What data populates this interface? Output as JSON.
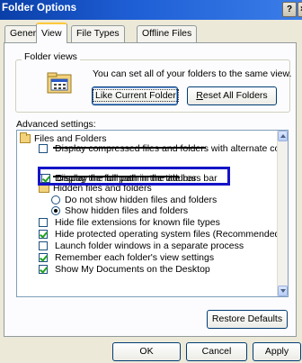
{
  "window": {
    "title": "Folder Options",
    "help_label": "?",
    "close_label": "×"
  },
  "tabs": [
    {
      "label": "General"
    },
    {
      "label": "View"
    },
    {
      "label": "File Types"
    },
    {
      "label": "Offline Files"
    }
  ],
  "folder_views": {
    "title": "Folder views",
    "description": "You can set all of your folders to the same view.",
    "like_current_label": "Like Current Folder",
    "reset_all_label": "Reset All Folders"
  },
  "advanced": {
    "label": "Advanced settings:",
    "group_label": "Files and Folders",
    "obscured_label": "Display compressed files and folders with alternate color",
    "highlighted_label": "Display the full path in the address bar",
    "obscured_label_2": "Display the full path in the title bar",
    "hidden_group_label": "Hidden files and folders",
    "hidden_option_1": "Do not show hidden files and folders",
    "hidden_option_2": "Show hidden files and folders",
    "item_hide_ext": "Hide file extensions for known file types",
    "item_hide_protected": "Hide protected operating system files (Recommended)",
    "item_launch_separate": "Launch folder windows in a separate process",
    "item_remember": "Remember each folder's view settings",
    "item_show_mydocs": "Show My Documents on the Desktop"
  },
  "buttons": {
    "restore_defaults": "Restore Defaults",
    "ok": "OK",
    "cancel": "Cancel",
    "apply": "Apply"
  },
  "state": {
    "active_tab": "View",
    "highlight_color": "#1414c8",
    "checked": {
      "highlighted_label": true,
      "hidden_option_2": true,
      "item_hide_ext": false,
      "item_hide_protected": true,
      "item_launch_separate": false,
      "item_remember": true,
      "item_show_mydocs": true
    }
  }
}
